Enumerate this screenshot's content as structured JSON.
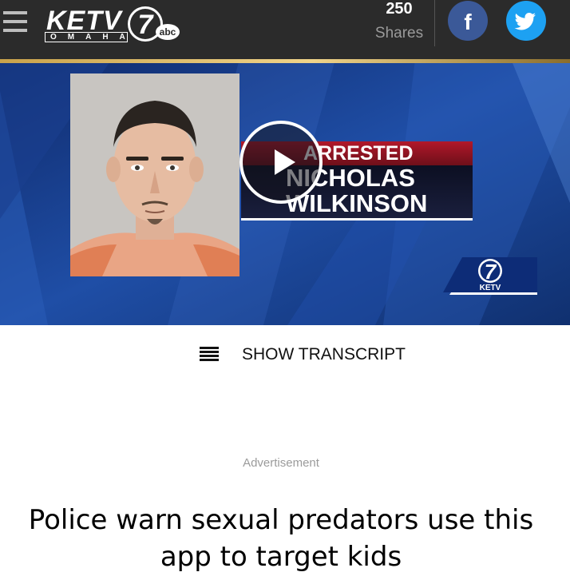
{
  "header": {
    "logo_word": "KETV",
    "logo_city": "OMAHA",
    "logo_number": "7",
    "logo_network": "abc",
    "shares_count": "250",
    "shares_label": "Shares",
    "facebook_glyph": "f"
  },
  "video": {
    "lower_third_line1": "ARRESTED",
    "lower_third_line2": "NICHOLAS",
    "lower_third_line3": "WILKINSON",
    "station_bug_number": "7",
    "station_bug_label": "KETV"
  },
  "transcript_toggle": {
    "label": "SHOW TRANSCRIPT"
  },
  "ad_label": "Advertisement",
  "headline": "Police warn sexual predators use this app to target kids",
  "colors": {
    "topbar": "#2b2b2b",
    "facebook": "#3b5998",
    "twitter": "#1da1f2",
    "lower_third_red": "#b1182a",
    "video_blue": "#14306e"
  },
  "icons": {
    "menu": "hamburger-menu-icon",
    "facebook": "facebook-icon",
    "twitter": "twitter-bird-icon",
    "play": "play-icon",
    "transcript": "transcript-lines-icon"
  }
}
